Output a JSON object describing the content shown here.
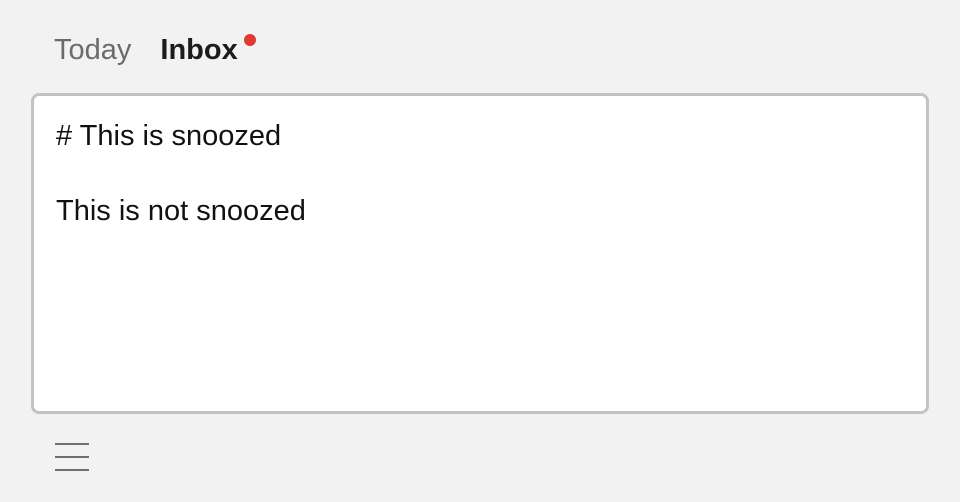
{
  "tabs": {
    "today_label": "Today",
    "inbox_label": "Inbox",
    "inbox_notification_color": "#e03a33"
  },
  "editor": {
    "lines": [
      "# This is snoozed",
      "This is not snoozed"
    ]
  },
  "footer": {
    "menu_icon": "hamburger-menu-icon"
  }
}
